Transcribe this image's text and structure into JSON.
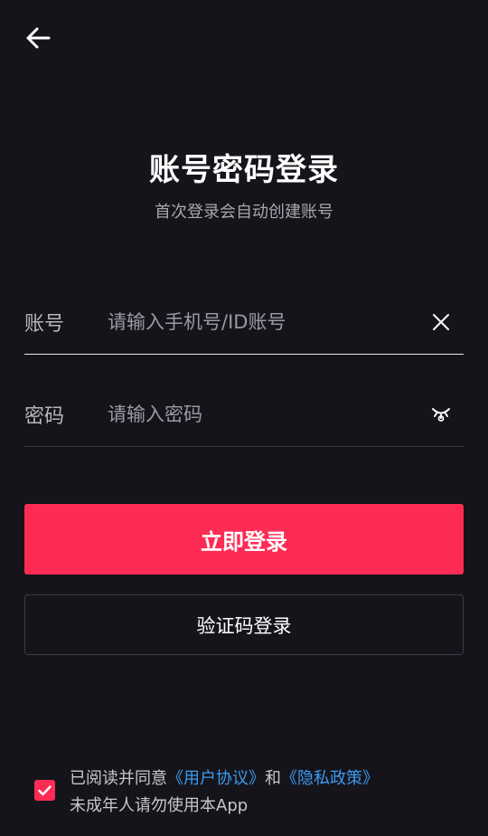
{
  "header": {
    "back_icon": "arrow-left-icon"
  },
  "title": "账号密码登录",
  "subtitle": "首次登录会自动创建账号",
  "account": {
    "label": "账号",
    "placeholder": "请输入手机号/ID账号",
    "value": "",
    "clear_icon": "close-icon"
  },
  "password": {
    "label": "密码",
    "placeholder": "请输入密码",
    "value": "",
    "toggle_icon": "eye-closed-icon"
  },
  "buttons": {
    "login": "立即登录",
    "code_login": "验证码登录"
  },
  "agreement": {
    "checked": true,
    "prefix": "已阅读并同意",
    "user_agreement": "《用户协议》",
    "and": "和",
    "privacy_policy": "《隐私政策》",
    "minor_notice": "未成年人请勿使用本App"
  },
  "colors": {
    "background": "#16141b",
    "accent": "#fe2c55",
    "link": "#3a9bf0"
  }
}
